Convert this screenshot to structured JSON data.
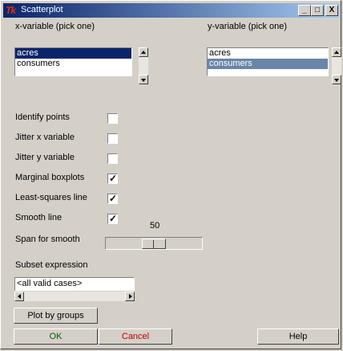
{
  "window": {
    "title": "Scatterplot",
    "logo": "Tk"
  },
  "titlebar_buttons": {
    "minimize": "_",
    "maximize": "□",
    "close": "X"
  },
  "x_variable": {
    "label": "x-variable (pick one)",
    "items": [
      "acres",
      "consumers"
    ],
    "selected": "acres"
  },
  "y_variable": {
    "label": "y-variable (pick one)",
    "items": [
      "acres",
      "consumers"
    ],
    "selected": "consumers"
  },
  "options": [
    {
      "label": "Identify points",
      "checked": false
    },
    {
      "label": "Jitter x variable",
      "checked": false
    },
    {
      "label": "Jitter y variable",
      "checked": false
    },
    {
      "label": "Marginal boxplots",
      "checked": true
    },
    {
      "label": "Least-squares line",
      "checked": true
    },
    {
      "label": "Smooth line",
      "checked": true
    }
  ],
  "span": {
    "label": "Span for smooth",
    "value": "50"
  },
  "subset": {
    "label": "Subset expression",
    "value": "<all valid cases>"
  },
  "buttons": {
    "plot_by_groups": "Plot by groups",
    "ok": "OK",
    "cancel": "Cancel",
    "help": "Help"
  },
  "colors": {
    "ok_text": "#006000",
    "cancel_text": "#c00000",
    "selection": "#0a246a",
    "selection_inactive": "#6a85a8"
  }
}
